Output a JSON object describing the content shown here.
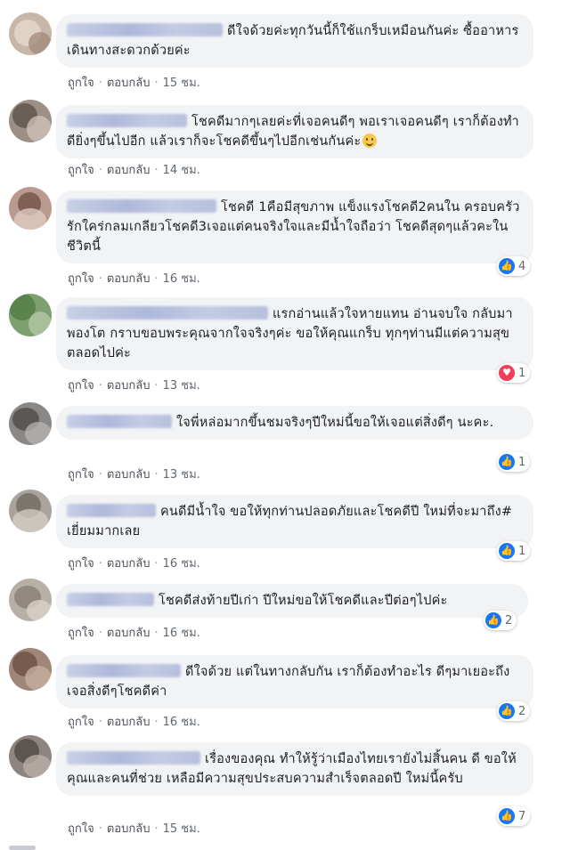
{
  "labels": {
    "like": "ถูกใจ",
    "reply": "ตอบกลับ",
    "sep": "·"
  },
  "comments": [
    {
      "text": "ดีใจด้วยค่ะทุกวันนี้ก็ใช้แกร็บเหมือนกันค่ะ ซื้ออาหารเดินทางสะดวกด้วยค่ะ",
      "time": "15 ชม."
    },
    {
      "text": "โชคดีมากๆเลยค่ะที่เจอคนดีๆ พอเราเจอคนดีๆ เราก็ต้องทำดียิ่งๆขึ้นไปอีก แล้วเราก็จะโชคดีขึ้นๆไปอีกเช่นกันค่ะ",
      "time": "14 ชม.",
      "emoji": "smiling-face-emoji"
    },
    {
      "text": "โชคดี 1คือมีสุขภาพ แข็งแรงโชคดี2คนใน ครอบครัวรักใคร่กลมเกลียวโชคดี3เจอแต่คนจริงใจและมีน้ำใจถือว่า โชคดีสุดๆแล้วคะในชีวิตนี้",
      "time": "16 ชม.",
      "reaction": {
        "type": "like",
        "icon": "👍",
        "count": "4"
      }
    },
    {
      "text": "แรกอ่านแล้วใจหายแทน อ่านจบใจ กลับมาพองโต กราบขอบพระคุณจากใจจริงๆค่ะ ขอให้คุณแกร็บ ทุกๆท่านมีแต่ความสุขตลอดไปค่ะ",
      "time": "13 ชม.",
      "reaction": {
        "type": "love",
        "icon": "♥",
        "count": "1"
      }
    },
    {
      "text": "ใจพี่หล่อมากขึ้นชมจริงๆปีใหม่นี้ขอให้เจอแต่สิ่งดีๆ นะคะ.",
      "time": "13 ชม.",
      "reaction": {
        "type": "like",
        "icon": "👍",
        "count": "1"
      }
    },
    {
      "text": "คนดีมีน้ำใจ ขอให้ทุกท่านปลอดภัยและโชคดีปี ใหม่ที่จะมาถึง# เยี่ยมมากเลย",
      "time": "16 ชม.",
      "reaction": {
        "type": "like",
        "icon": "👍",
        "count": "1"
      }
    },
    {
      "text": "โชคดีส่งท้ายปีเก่า ปีใหม่ขอให้โชคดีและปีต่อๆไปค่ะ",
      "time": "16 ชม.",
      "reaction": {
        "type": "like",
        "icon": "👍",
        "count": "2"
      }
    },
    {
      "text": "ดีใจด้วย แต่ในทางกลับกัน เราก็ต้องทำอะไร ดีๆมาเยอะถึงเจอสิ่งดีๆโชคดีค่า",
      "time": "16 ชม.",
      "reaction": {
        "type": "like",
        "icon": "👍",
        "count": "2"
      }
    },
    {
      "text": "เรื่องของคุณ ทำให้รู้ว่าเมืองไทยเรายังไม่สิ้นคน ดี ขอให้คุณและคนที่ช่วย เหลือมีความสุขประสบความสำเร็จตลอดปี ใหม่นี้ครับ",
      "time": "15 ชม.",
      "reaction": {
        "type": "like",
        "icon": "👍",
        "count": "7"
      }
    }
  ]
}
